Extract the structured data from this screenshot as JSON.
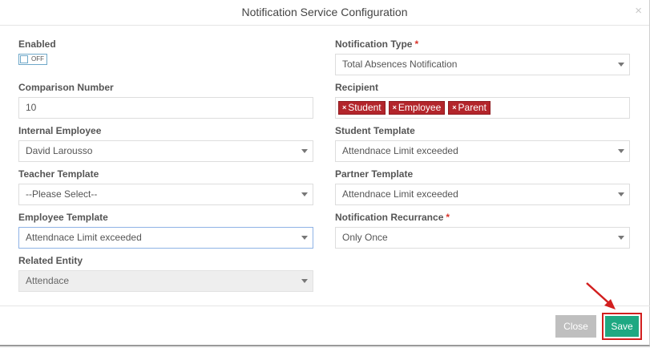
{
  "dialog": {
    "title": "Notification Service Configuration",
    "close_glyph": "×"
  },
  "left": {
    "enabled": {
      "label": "Enabled",
      "toggle_text": "OFF"
    },
    "comparison_number": {
      "label": "Comparison Number",
      "value": "10"
    },
    "internal_employee": {
      "label": "Internal Employee",
      "value": "David Larousso"
    },
    "teacher_template": {
      "label": "Teacher Template",
      "value": "--Please Select--"
    },
    "employee_template": {
      "label": "Employee Template",
      "value": "Attendnace Limit exceeded"
    },
    "related_entity": {
      "label": "Related Entity",
      "value": "Attendace"
    }
  },
  "right": {
    "notification_type": {
      "label": "Notification Type",
      "required": "*",
      "value": "Total Absences Notification"
    },
    "recipient": {
      "label": "Recipient",
      "tags": [
        "Student",
        "Employee",
        "Parent"
      ],
      "tag_remove_glyph": "×"
    },
    "student_template": {
      "label": "Student Template",
      "value": "Attendnace Limit exceeded"
    },
    "partner_template": {
      "label": "Partner Template",
      "value": "Attendnace Limit exceeded"
    },
    "notification_recurrance": {
      "label": "Notification Recurrance",
      "required": "*",
      "value": "Only Once"
    }
  },
  "footer": {
    "close_label": "Close",
    "save_label": "Save"
  },
  "colors": {
    "save": "#1ea882",
    "tag": "#b3252b",
    "highlight": "#d21f1f"
  }
}
